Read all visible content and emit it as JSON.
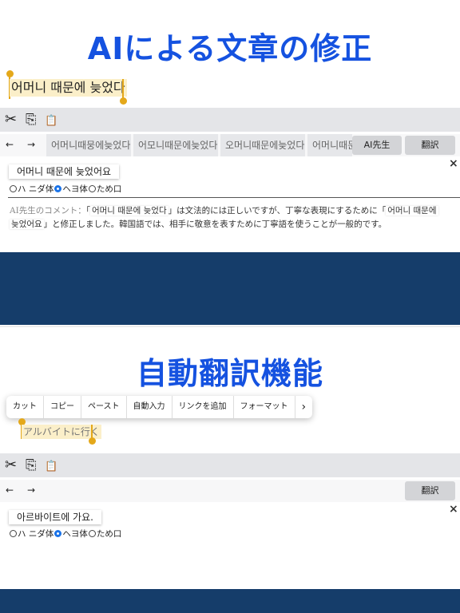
{
  "section1": {
    "headline": "AIによる文章の修正",
    "selected_text": "어머니 때문에 늦었다",
    "toolbar": {
      "cut_icon": "✂",
      "copy_icon": "⎘",
      "paste_icon": "📋"
    },
    "nav": {
      "back": "←",
      "forward": "→"
    },
    "suggestions": [
      "어머니때뭉에늦었다",
      "어모니때문에늦었다",
      "오머니때문에늦었다",
      "어머니때문"
    ],
    "ai_button": "AI先生",
    "translate_button": "翻訳",
    "close": "×",
    "result": "어머니 때문에 늦었어요",
    "radios": [
      {
        "label": "ハ ニダ体",
        "checked": false
      },
      {
        "label": "ヘヨ体",
        "checked": true
      },
      {
        "label": "ため口",
        "checked": false
      }
    ],
    "comment_label": "AI先生のコメント：",
    "comment_part1": "「",
    "comment_quote1": "어머니 때문에 늦었다",
    "comment_part2": "」は文法的には正しいですが、丁寧な表現にするために「",
    "comment_quote2a": "어머니 때문에",
    "comment_quote2b": "늦었어요",
    "comment_part3": "」と修正しました。韓国語では、相手に敬意を表すために丁寧語を使うことが一般的です。"
  },
  "section2": {
    "headline": "自動翻訳機能",
    "context_menu": [
      "カット",
      "コピー",
      "ペースト",
      "自動入力",
      "リンクを追加",
      "フォーマット"
    ],
    "context_more": "›",
    "selected_text": "アルバイトに行く",
    "nav": {
      "back": "←",
      "forward": "→"
    },
    "translate_button": "翻訳",
    "close": "×",
    "result": "아르바이트에 가요.",
    "radios": [
      {
        "label": "ハ ニダ体",
        "checked": false
      },
      {
        "label": "ヘヨ体",
        "checked": true
      },
      {
        "label": "ため口",
        "checked": false
      }
    ]
  },
  "colors": {
    "accent": "#1552e0",
    "navy": "#153d6a",
    "handle": "#e4a81a",
    "radio_on": "#1a73e8"
  }
}
